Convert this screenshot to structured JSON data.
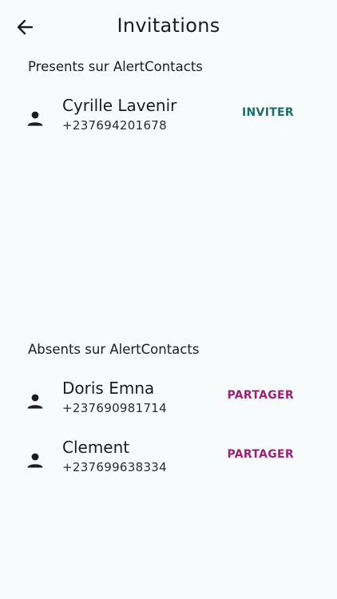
{
  "header": {
    "title": "Invitations",
    "back_icon": "arrow-left-icon"
  },
  "sections": {
    "present": {
      "title": "Presents sur AlertContacts",
      "contacts": [
        {
          "name": "Cyrille Lavenir",
          "phone": "+237694201678",
          "action": "INVITER"
        }
      ]
    },
    "absent": {
      "title": "Absents sur AlertContacts",
      "contacts": [
        {
          "name": "Doris Emna",
          "phone": "+237690981714",
          "action": "PARTAGER"
        },
        {
          "name": "Clement",
          "phone": "+237699638334",
          "action": "PARTAGER"
        }
      ]
    }
  },
  "colors": {
    "background": "#f7fbfc",
    "invite_action": "#1d6e6b",
    "share_action": "#9a2378"
  }
}
